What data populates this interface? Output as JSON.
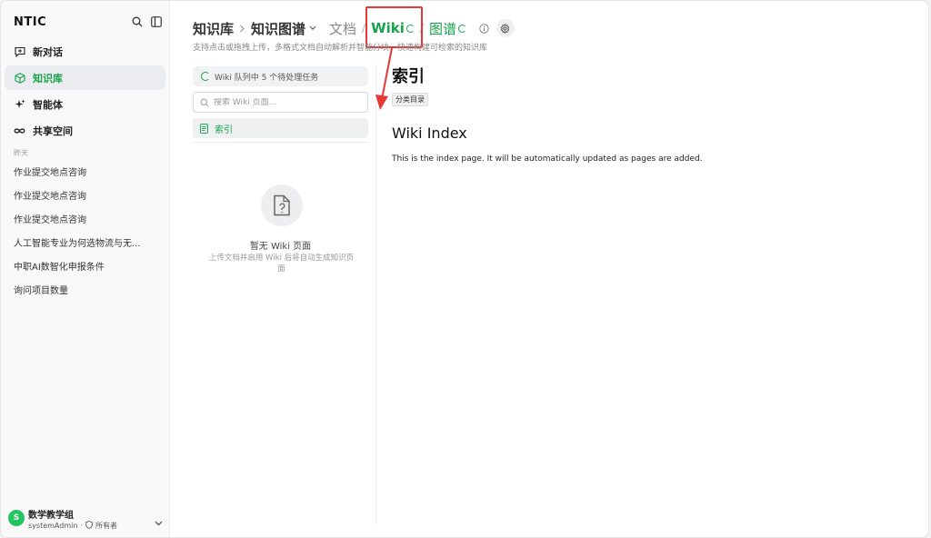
{
  "sidebar": {
    "logo": "NTIC",
    "logo_sub": "",
    "nav": [
      {
        "label": "新对话",
        "icon": "chat-add-icon"
      },
      {
        "label": "知识库",
        "icon": "knowledge-cube-icon",
        "active": true
      },
      {
        "label": "智能体",
        "icon": "sparkle-icon"
      },
      {
        "label": "共享空间",
        "icon": "infinity-icon"
      }
    ],
    "section_label": "昨天",
    "history": [
      "作业提交地点咨询",
      "作业提交地点咨询",
      "作业提交地点咨询",
      "人工智能专业为何选物流与无...",
      "中职AI数智化申报条件",
      "询问项目数量"
    ],
    "user": {
      "initial": "S",
      "name": "数学教学组",
      "account": "systemAdmin",
      "separator": "·",
      "role": "所有者"
    }
  },
  "breadcrumb": {
    "kb": "知识库",
    "graph_dropdown": "知识图谱",
    "docs": "文档",
    "wiki": "Wiki",
    "graph_tab": "图谱",
    "sep": "/"
  },
  "subtitle": "支持点击或拖拽上传，多格式文档自动解析并智能分块，快速构建可检索的知识库",
  "wiki_panel": {
    "queue_text": "Wiki 队列中 5 个待处理任务",
    "search_placeholder": "搜索 Wiki 页面...",
    "index_item": "索引",
    "empty_title": "暂无 Wiki 页面",
    "empty_desc": "上传文档并启用 Wiki 后将自动生成知识页面"
  },
  "content": {
    "title": "索引",
    "tag": "分类目录",
    "heading": "Wiki Index",
    "paragraph": "This is the index page. It will be automatically updated as pages are added."
  },
  "colors": {
    "accent": "#16a34a",
    "annotation": "#e53935"
  }
}
